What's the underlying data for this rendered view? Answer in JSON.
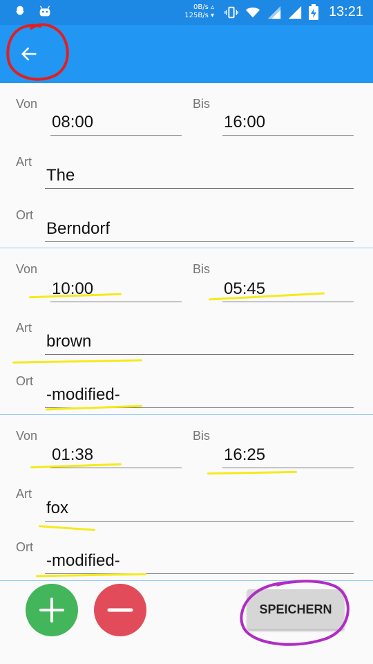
{
  "statusbar": {
    "net_up": "0B/s ▵",
    "net_down": "125B/s ▾",
    "time": "13:21"
  },
  "toolbar": {
    "back_icon": "arrow-left-icon"
  },
  "entries": [
    {
      "von_label": "Von",
      "von": "08:00",
      "bis_label": "Bis",
      "bis": "16:00",
      "art_label": "Art",
      "art": "The",
      "ort_label": "Ort",
      "ort": "Berndorf"
    },
    {
      "von_label": "Von",
      "von": "10:00",
      "bis_label": "Bis",
      "bis": "05:45",
      "art_label": "Art",
      "art": "brown",
      "ort_label": "Ort",
      "ort": "-modified-"
    },
    {
      "von_label": "Von",
      "von": "01:38",
      "bis_label": "Bis",
      "bis": "16:25",
      "art_label": "Art",
      "art": "fox",
      "ort_label": "Ort",
      "ort": "-modified-"
    }
  ],
  "actions": {
    "add_icon": "plus-icon",
    "remove_icon": "minus-icon",
    "save_label": "SPEICHERN"
  },
  "colors": {
    "primary": "#2196f3",
    "primary_dark": "#1e88e5",
    "add": "#43b55a",
    "remove": "#e14b5a",
    "highlight": "#f5ea1a"
  }
}
